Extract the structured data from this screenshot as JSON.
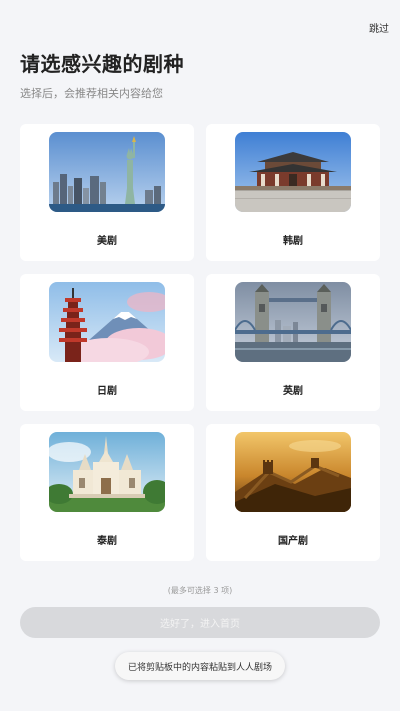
{
  "header": {
    "skip_label": "跳过",
    "title": "请选感兴趣的剧种",
    "subtitle": "选择后，会推荐相关内容给您"
  },
  "genres": [
    {
      "label": "美剧",
      "image": "statue-of-liberty"
    },
    {
      "label": "韩剧",
      "image": "korean-palace"
    },
    {
      "label": "日剧",
      "image": "mount-fuji-pagoda"
    },
    {
      "label": "英剧",
      "image": "tower-bridge"
    },
    {
      "label": "泰剧",
      "image": "thai-temple"
    },
    {
      "label": "国产剧",
      "image": "great-wall"
    }
  ],
  "footer": {
    "hint": "(最多可选择 3 项)",
    "confirm_label": "选好了，进入首页",
    "toast": "已将剪贴板中的内容粘贴到人人剧场"
  },
  "colors": {
    "background": "#f4f5f8",
    "card": "#ffffff",
    "button_disabled": "#d8d9dc"
  }
}
